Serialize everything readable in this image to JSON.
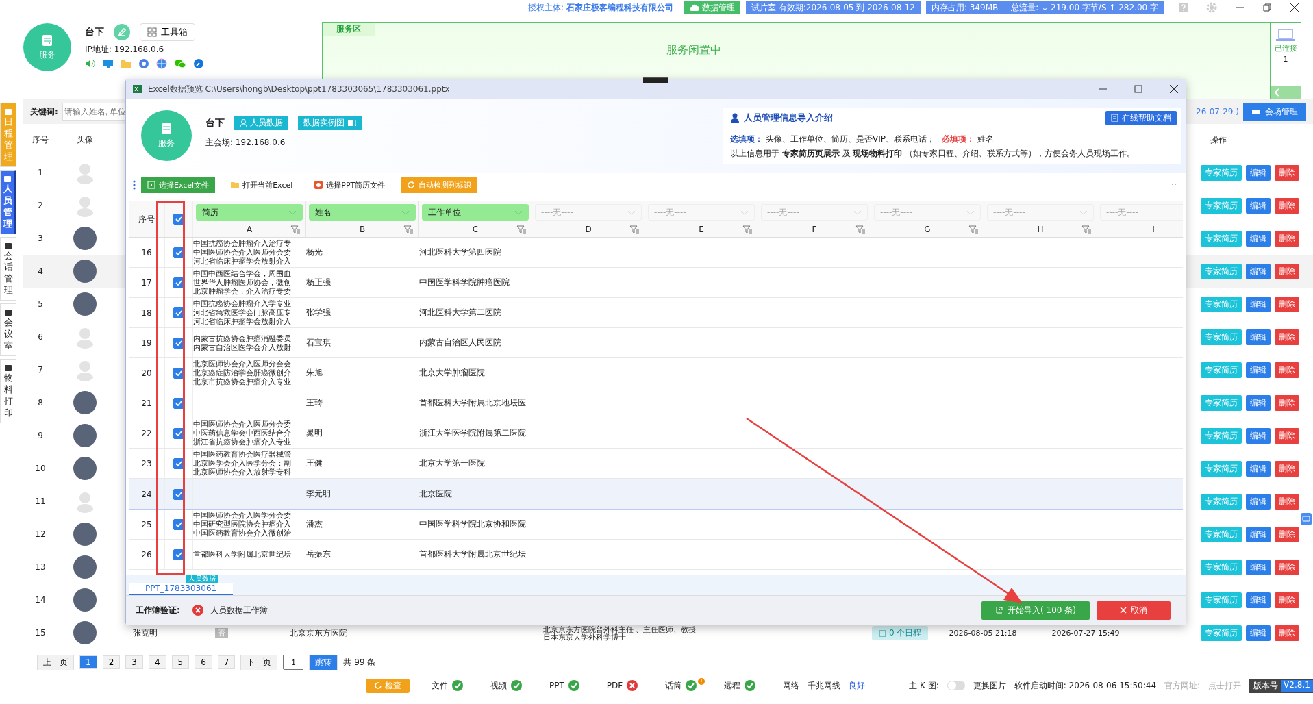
{
  "topbar": {
    "license_label": "授权主体:",
    "license_holder": "石家庄极客编程科技有限公司",
    "data_button": "数据管理",
    "trial": "试片室 有效期:2026-08-05 到 2026-08-12",
    "memory": "内存占用:  349MB",
    "traffic": "总流量:  ↓ 219.00 字节/S    ↑ 282.00 字"
  },
  "station": {
    "logo_label": "服务",
    "name": "台下",
    "toolbox": "工具箱",
    "ip": "IP地址: 192.168.0.6"
  },
  "service_area": {
    "tab": "服务区",
    "status": "服务闲置中",
    "connected_label": "已连接",
    "connected_count": "1"
  },
  "side_tabs": [
    {
      "label": "日程管理",
      "selected": false,
      "color": "#f0a81c"
    },
    {
      "label": "人员管理",
      "selected": true,
      "color": "#3b6ff0"
    },
    {
      "label": "会话管理",
      "selected": false,
      "color": "#ffffff"
    },
    {
      "label": "会议室",
      "selected": false,
      "color": "#ffffff"
    },
    {
      "label": "物料打印",
      "selected": false,
      "color": "#ffffff"
    }
  ],
  "search": {
    "label": "关键词:",
    "placeholder": "请输入姓名, 单位",
    "date_fragment": "26-07-29 )",
    "venue_button": "会场管理"
  },
  "list": {
    "columns": [
      "序号",
      "头像",
      "操作"
    ],
    "rows": [
      {
        "index": "1",
        "kind": "placeholder",
        "hover": false,
        "actions": [
          "专家简历",
          "编辑",
          "删除"
        ]
      },
      {
        "index": "2",
        "kind": "placeholder",
        "hover": false,
        "actions": [
          "专家简历",
          "编辑",
          "删除"
        ]
      },
      {
        "index": "3",
        "kind": "photo",
        "hover": false,
        "actions": [
          "专家简历",
          "编辑",
          "删除"
        ]
      },
      {
        "index": "4",
        "kind": "photo",
        "hover": true,
        "actions": [
          "专家简历",
          "编辑",
          "删除"
        ]
      },
      {
        "index": "5",
        "kind": "photo",
        "hover": false,
        "actions": [
          "专家简历",
          "编辑",
          "删除"
        ]
      },
      {
        "index": "6",
        "kind": "placeholder",
        "hover": false,
        "actions": [
          "专家简历",
          "编辑",
          "删除"
        ]
      },
      {
        "index": "7",
        "kind": "placeholder",
        "hover": false,
        "actions": [
          "专家简历",
          "编辑",
          "删除"
        ]
      },
      {
        "index": "8",
        "kind": "photo",
        "hover": false,
        "actions": [
          "专家简历",
          "编辑",
          "删除"
        ]
      },
      {
        "index": "9",
        "kind": "photo",
        "hover": false,
        "actions": [
          "专家简历",
          "编辑",
          "删除"
        ]
      },
      {
        "index": "10",
        "kind": "photo",
        "hover": false,
        "actions": [
          "专家简历",
          "编辑",
          "删除"
        ]
      },
      {
        "index": "11",
        "kind": "placeholder",
        "hover": false,
        "actions": [
          "专家简历",
          "编辑",
          "删除"
        ]
      },
      {
        "index": "12",
        "kind": "photo",
        "hover": false,
        "actions": [
          "专家简历",
          "编辑",
          "删除"
        ]
      },
      {
        "index": "13",
        "kind": "photo",
        "hover": false,
        "actions": [
          "专家简历",
          "编辑",
          "删除"
        ]
      },
      {
        "index": "14",
        "kind": "photo",
        "hover": false,
        "actions": [
          "专家简历",
          "编辑",
          "删除"
        ]
      },
      {
        "index": "15",
        "kind": "photo",
        "hover": false,
        "actions": [
          "专家简历",
          "编辑",
          "删除"
        ],
        "name": "张克明",
        "vip": "否",
        "unit": "北京京东方医院",
        "resume": [
          "北京京东方医院普外科主任 、主任医师、教授",
          "日本东京大学外科学博士"
        ],
        "schedule": "0 个日程",
        "created": "2026-08-05 21:18",
        "updated": "2026-07-27 15:49"
      }
    ]
  },
  "pagination": {
    "prev": "上一页",
    "pages": [
      {
        "label": "1",
        "selected": true
      },
      {
        "label": "2",
        "selected": false
      },
      {
        "label": "3",
        "selected": false
      },
      {
        "label": "4",
        "selected": false
      },
      {
        "label": "5",
        "selected": false
      },
      {
        "label": "6",
        "selected": false
      },
      {
        "label": "7",
        "selected": false
      }
    ],
    "next": "下一页",
    "page_value": "1",
    "jump": "跳转",
    "total": "共 99 条"
  },
  "status_bar": {
    "check_button": "检查",
    "items": [
      {
        "label": "文件",
        "ok": true,
        "alert": false
      },
      {
        "label": "视频",
        "ok": true,
        "alert": false
      },
      {
        "label": "PPT",
        "ok": true,
        "alert": false
      },
      {
        "label": "PDF",
        "ok": false,
        "alert": false
      },
      {
        "label": "话筒",
        "ok": true,
        "alert": true
      },
      {
        "label": "远程",
        "ok": true,
        "alert": false
      }
    ],
    "network_label": "网络",
    "network_type": "千兆网线",
    "network_quality": "良好",
    "kmap_label": "主 K 图:",
    "kmap_on": false,
    "change_image": "更换图片",
    "start_time": "软件启动时间:  2026-08-06 15:50:44",
    "website_label": "官方网址:",
    "website_link": "点击打开",
    "version_label": "版本号",
    "version": "V2.8.1"
  },
  "dialog": {
    "title": "Excel数据预览 C:\\Users\\hongb\\Desktop\\ppt1783303065\\1783303061.pptx",
    "logo_label": "服务",
    "name": "台下",
    "people_button": "人员数据",
    "example_button": "数据实例图",
    "host": "主会场: 192.168.0.6",
    "intro": {
      "title": "人员管理信息导入介绍",
      "help_button": "在线帮助文档",
      "optional_label": "选填项：",
      "optional_text": "头像、工作单位、简历、是否VIP、联系电话；",
      "required_label": "必填项：",
      "required_text": "姓名",
      "usage": "以上信息用于 **专家简历页展示** 及 **现场物料打印** （如专家日程、介绍、联系方式等），方便会务人员现场工作。"
    },
    "toolbar": [
      {
        "label": "选择Excel文件",
        "kind": "primary"
      },
      {
        "label": "打开当前Excel",
        "kind": "folder"
      },
      {
        "label": "选择PPT简历文件",
        "kind": "ppt"
      },
      {
        "label": "自动检测列标识",
        "kind": "warning"
      }
    ],
    "table": {
      "index_header": "序号",
      "all_checked": true,
      "columns": [
        {
          "mapping": "简历",
          "mapped": true,
          "letter": "A",
          "filter": true
        },
        {
          "mapping": "姓名",
          "mapped": true,
          "letter": "B",
          "filter": true
        },
        {
          "mapping": "工作单位",
          "mapped": true,
          "letter": "C",
          "filter": true
        },
        {
          "mapping": "----无----",
          "mapped": false,
          "letter": "D",
          "filter": true
        },
        {
          "mapping": "----无----",
          "mapped": false,
          "letter": "E",
          "filter": true
        },
        {
          "mapping": "----无----",
          "mapped": false,
          "letter": "F",
          "filter": true
        },
        {
          "mapping": "----无----",
          "mapped": false,
          "letter": "G",
          "filter": true
        },
        {
          "mapping": "----无----",
          "mapped": false,
          "letter": "H",
          "filter": true
        },
        {
          "mapping": "----无----",
          "mapped": false,
          "letter": "I",
          "filter": false
        }
      ],
      "rows": [
        {
          "index": "16",
          "checked": true,
          "selected": false,
          "resume": [
            "中国抗癌协会肿瘤介入治疗专",
            "中国医师协会介入医师分会委",
            "河北省临床肿瘤学会放射介入"
          ],
          "name": "杨光",
          "unit": "河北医科大学第四医院"
        },
        {
          "index": "17",
          "checked": true,
          "selected": false,
          "resume": [
            "中国中西医结合学会，周围血",
            "世界华人肿瘤医师协会，微创",
            "北京肿瘤学会，介入治疗专委"
          ],
          "name": "杨正强",
          "unit": "中国医学科学院肿瘤医院"
        },
        {
          "index": "18",
          "checked": true,
          "selected": false,
          "resume": [
            "中国抗癌协会肿瘤介入学专业",
            "河北省急救医学会门脉高压专",
            "河北省临床肿瘤学会放射介入"
          ],
          "name": "张学强",
          "unit": "河北医科大学第二医院"
        },
        {
          "index": "19",
          "checked": true,
          "selected": false,
          "resume": [
            "内蒙古抗癌协会肿瘤消融委员",
            "内蒙古自治区医学会介入放射"
          ],
          "name": "石宝琪",
          "unit": "内蒙古自治区人民医院"
        },
        {
          "index": "20",
          "checked": true,
          "selected": false,
          "resume": [
            "北京医师协会介入医师分会会",
            "北京癌症防治学会肝癌微创介",
            "北京市抗癌协会肿瘤介入专业"
          ],
          "name": "朱旭",
          "unit": "北京大学肿瘤医院"
        },
        {
          "index": "21",
          "checked": true,
          "selected": false,
          "resume": [],
          "name": "王琦",
          "unit": "首都医科大学附属北京地坛医"
        },
        {
          "index": "22",
          "checked": true,
          "selected": false,
          "resume": [
            "中国医师协会介入医师分会委",
            "中医药信息学会中西医结合介",
            "浙江省抗癌协会肿瘤介入专业"
          ],
          "name": "晁明",
          "unit": "浙江大学医学院附属第二医院"
        },
        {
          "index": "23",
          "checked": true,
          "selected": false,
          "resume": [
            "中国医药教育协会医疗器械管",
            "北京医学会介入医学分会：副",
            "北京医师协会介入放射学专科"
          ],
          "name": "王健",
          "unit": "北京大学第一医院"
        },
        {
          "index": "24",
          "checked": true,
          "selected": true,
          "resume": [],
          "name": "李元明",
          "unit": "北京医院"
        },
        {
          "index": "25",
          "checked": true,
          "selected": false,
          "resume": [
            "中国医师协会介入医学分会委",
            "中国研究型医院协会肿瘤介入",
            "中国医药教育协会介入微创治"
          ],
          "name": "潘杰",
          "unit": "中国医学科学院北京协和医院"
        },
        {
          "index": "26",
          "checked": true,
          "selected": false,
          "resume": [
            "首都医科大学附属北京世纪坛"
          ],
          "name": "岳振东",
          "unit": "首都医科大学附属北京世纪坛"
        }
      ]
    },
    "sheet_tabs": [
      {
        "label": "PPT_1783303061",
        "badge": "人员数据",
        "selected": true
      }
    ],
    "footer": {
      "label": "工作簿验证:",
      "valid": false,
      "sheet": "人员数据工作簿",
      "import_button": "开始导入( 100 条)",
      "cancel_button": "取消"
    }
  }
}
